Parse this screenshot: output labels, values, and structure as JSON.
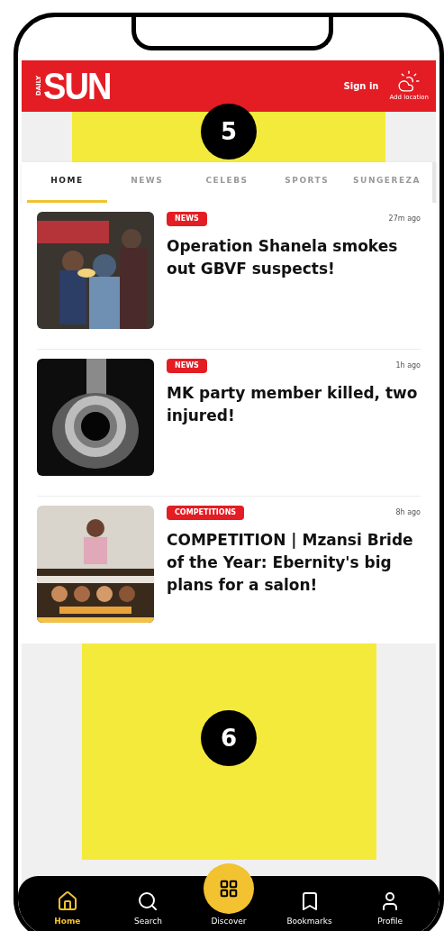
{
  "header": {
    "logo_small": "DAILY",
    "logo": "SUN",
    "sign_in": "Sign in",
    "add_location": "Add location"
  },
  "top_ad": {
    "marker": "5"
  },
  "tabs": [
    {
      "label": "HOME",
      "selected": true
    },
    {
      "label": "NEWS",
      "selected": false
    },
    {
      "label": "CELEBS",
      "selected": false
    },
    {
      "label": "SPORTS",
      "selected": false
    },
    {
      "label": "SUNGEREZA",
      "selected": false
    }
  ],
  "articles": [
    {
      "category": "NEWS",
      "time": "27m ago",
      "headline": "Operation Shanela smokes out GBVF suspects!"
    },
    {
      "category": "NEWS",
      "time": "1h ago",
      "headline": "MK party member killed, two injured!"
    },
    {
      "category": "COMPETITIONS",
      "time": "8h ago",
      "headline": "COMPETITION | Mzansi Bride of the Year: Ebernity's big plans for a salon!"
    }
  ],
  "bottom_ad": {
    "marker": "6"
  },
  "nav": [
    {
      "label": "Home",
      "kind": "home",
      "selected": true
    },
    {
      "label": "Search",
      "kind": "search",
      "selected": false
    },
    {
      "label": "Discover",
      "kind": "discover",
      "selected": false
    },
    {
      "label": "Bookmarks",
      "kind": "bookmarks",
      "selected": false
    },
    {
      "label": "Profile",
      "kind": "profile",
      "selected": false
    }
  ]
}
